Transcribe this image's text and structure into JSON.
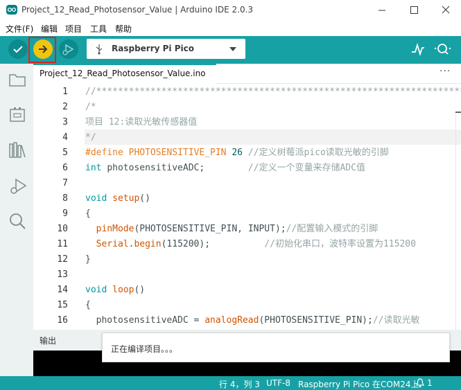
{
  "window": {
    "title": "Project_12_Read_Photosensor_Value | Arduino IDE 2.0.3"
  },
  "menubar": {
    "items": [
      "文件(F)",
      "编辑",
      "项目",
      "工具",
      "帮助"
    ]
  },
  "toolbar": {
    "board_name": "Raspberry Pi Pico"
  },
  "editor": {
    "tab_label": "Project_12_Read_Photosensor_Value.ino",
    "tab_more": "···",
    "cursor_line": 4,
    "lines": [
      {
        "n": "1",
        "tokens": [
          {
            "t": "//**********************************************************************",
            "c": "comment"
          }
        ]
      },
      {
        "n": "2",
        "tokens": [
          {
            "t": "/*",
            "c": "comment"
          }
        ]
      },
      {
        "n": "3",
        "tokens": [
          {
            "t": "项目 12:读取光敏传感器值",
            "c": "comment"
          }
        ]
      },
      {
        "n": "4",
        "tokens": [
          {
            "t": "*/",
            "c": "comment"
          }
        ]
      },
      {
        "n": "5",
        "tokens": [
          {
            "t": "#define ",
            "c": "macro"
          },
          {
            "t": "PHOTOSENSITIVE_PIN ",
            "c": "macro"
          },
          {
            "t": "26 ",
            "c": "num"
          },
          {
            "t": "//定义树莓派pico读取光敏的引脚",
            "c": "comment"
          }
        ]
      },
      {
        "n": "6",
        "tokens": [
          {
            "t": "int ",
            "c": "kw"
          },
          {
            "t": "photosensitiveADC;        ",
            "c": "plain"
          },
          {
            "t": "//定义一个变量来存储ADC值",
            "c": "comment"
          }
        ]
      },
      {
        "n": "7",
        "tokens": []
      },
      {
        "n": "8",
        "tokens": [
          {
            "t": "void ",
            "c": "kw"
          },
          {
            "t": "setup",
            "c": "fn"
          },
          {
            "t": "()",
            "c": "plain"
          }
        ]
      },
      {
        "n": "9",
        "tokens": [
          {
            "t": "{",
            "c": "plain"
          }
        ]
      },
      {
        "n": "10",
        "tokens": [
          {
            "t": "  ",
            "c": "plain"
          },
          {
            "t": "pinMode",
            "c": "fn"
          },
          {
            "t": "(PHOTOSENSITIVE_PIN, INPUT);",
            "c": "plain"
          },
          {
            "t": "//配置输入模式的引脚",
            "c": "comment"
          }
        ]
      },
      {
        "n": "11",
        "tokens": [
          {
            "t": "  ",
            "c": "plain"
          },
          {
            "t": "Serial",
            "c": "fn"
          },
          {
            "t": ".",
            "c": "plain"
          },
          {
            "t": "begin",
            "c": "fn"
          },
          {
            "t": "(115200);          ",
            "c": "plain"
          },
          {
            "t": "//初始化串口，波特率设置为115200",
            "c": "comment"
          }
        ]
      },
      {
        "n": "12",
        "tokens": [
          {
            "t": "}",
            "c": "plain"
          }
        ]
      },
      {
        "n": "13",
        "tokens": []
      },
      {
        "n": "14",
        "tokens": [
          {
            "t": "void ",
            "c": "kw"
          },
          {
            "t": "loop",
            "c": "fn"
          },
          {
            "t": "()",
            "c": "plain"
          }
        ]
      },
      {
        "n": "15",
        "tokens": [
          {
            "t": "{",
            "c": "plain"
          }
        ]
      },
      {
        "n": "16",
        "tokens": [
          {
            "t": "  photosensitiveADC = ",
            "c": "plain"
          },
          {
            "t": "analogRead",
            "c": "fn"
          },
          {
            "t": "(PHOTOSENSITIVE_PIN);",
            "c": "plain"
          },
          {
            "t": "//读取光敏",
            "c": "comment"
          }
        ]
      }
    ]
  },
  "output": {
    "label": "输出",
    "notification": "正在编译项目。。。"
  },
  "statusbar": {
    "position": "行 4，列 3",
    "encoding": "UTF-8",
    "board_port": "Raspberry Pi Pico 在COM24上",
    "notification_count": "1"
  },
  "colors": {
    "accent": "#17a1a5",
    "upload_button": "#f1c40f",
    "highlight_box": "#e02020"
  },
  "icons": [
    "arduino-logo-icon",
    "minimize-icon",
    "maximize-icon",
    "close-icon",
    "verify-icon",
    "upload-icon",
    "debug-icon",
    "usb-icon",
    "dropdown-icon",
    "serial-plotter-icon",
    "serial-monitor-icon",
    "folder-icon",
    "board-icon",
    "library-icon",
    "debugger-icon",
    "search-icon",
    "bell-icon"
  ]
}
